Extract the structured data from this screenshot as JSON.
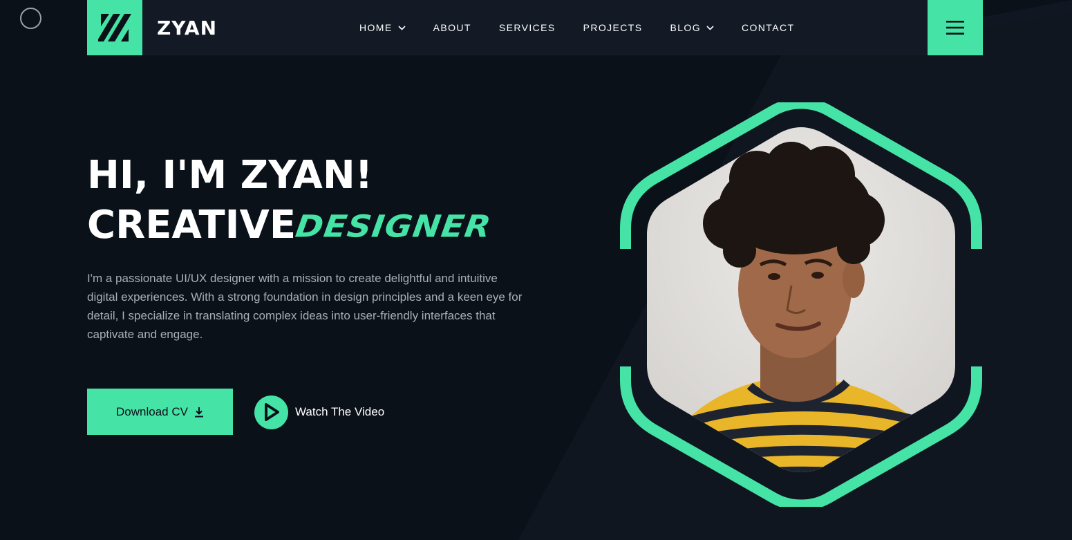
{
  "brand": {
    "name": "ZYAN"
  },
  "nav": {
    "items": [
      {
        "label": "HOME",
        "has_dropdown": true
      },
      {
        "label": "ABOUT",
        "has_dropdown": false
      },
      {
        "label": "SERVICES",
        "has_dropdown": false
      },
      {
        "label": "PROJECTS",
        "has_dropdown": false
      },
      {
        "label": "BLOG",
        "has_dropdown": true
      },
      {
        "label": "CONTACT",
        "has_dropdown": false
      }
    ]
  },
  "hero": {
    "line1": "HI, I'M ZYAN!",
    "line2_plain": "CREATIVE",
    "line2_accent": "DESIGNER",
    "bio": "I'm a passionate UI/UX designer with a mission to create delightful and intuitive digital experiences. With a strong foundation in design principles and a keen eye for detail, I specialize in translating complex ideas into user-friendly interfaces that captivate and engage.",
    "cv_label": "Download CV",
    "video_label": "Watch The Video"
  },
  "icons": {
    "logo": "slash-logo-icon",
    "menu": "hamburger-menu-icon",
    "download": "download-icon",
    "play": "play-icon",
    "dropdown": "chevron-down-icon"
  },
  "colors": {
    "accent": "#45e3a6",
    "background": "#0b1119",
    "header": "#131a25",
    "body_text": "#a9afb7"
  }
}
